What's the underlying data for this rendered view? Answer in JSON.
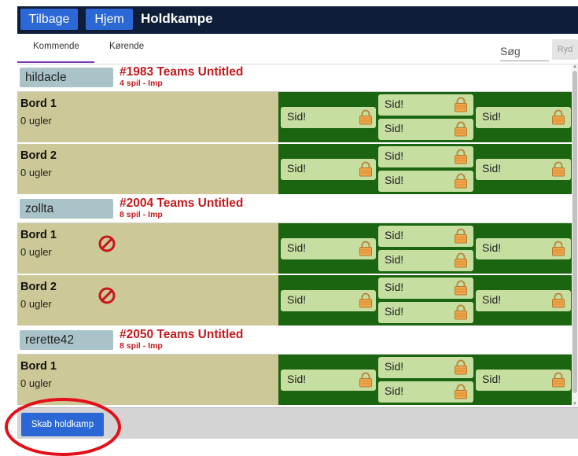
{
  "header": {
    "back_label": "Tilbage",
    "home_label": "Hjem",
    "title": "Holdkampe"
  },
  "tabs": [
    {
      "label": "Kommende"
    },
    {
      "label": "Kørende"
    }
  ],
  "search": {
    "placeholder": "Søg",
    "clear_label": "Ryd"
  },
  "teams": [
    {
      "player": "hildacle",
      "name": "#1983 Teams Untitled",
      "info": "4 spil - Imp",
      "tables": [
        {
          "name": "Bord 1",
          "owls": "0 ugler",
          "blocked": false
        },
        {
          "name": "Bord 2",
          "owls": "0 ugler",
          "blocked": false
        }
      ]
    },
    {
      "player": "zollta",
      "name": "#2004 Teams Untitled",
      "info": "8 spil - Imp",
      "tables": [
        {
          "name": "Bord 1",
          "owls": "0 ugler",
          "blocked": true
        },
        {
          "name": "Bord 2",
          "owls": "0 ugler",
          "blocked": true
        }
      ]
    },
    {
      "player": "rerette42",
      "name": "#2050 Teams Untitled",
      "info": "8 spil - Imp",
      "tables": [
        {
          "name": "Bord 1",
          "owls": "0 ugler",
          "blocked": false
        }
      ]
    }
  ],
  "seat_label": "Sid!",
  "footer": {
    "create_label": "Skab holdkamp"
  },
  "colors": {
    "header_bg": "#0f1e38",
    "button_blue": "#2b68d6",
    "team_red": "#c2191c",
    "table_tan": "#cdc897",
    "table_green": "#1b6410",
    "seat_green": "#c6dfa1",
    "annotation_red": "#e3101a"
  }
}
